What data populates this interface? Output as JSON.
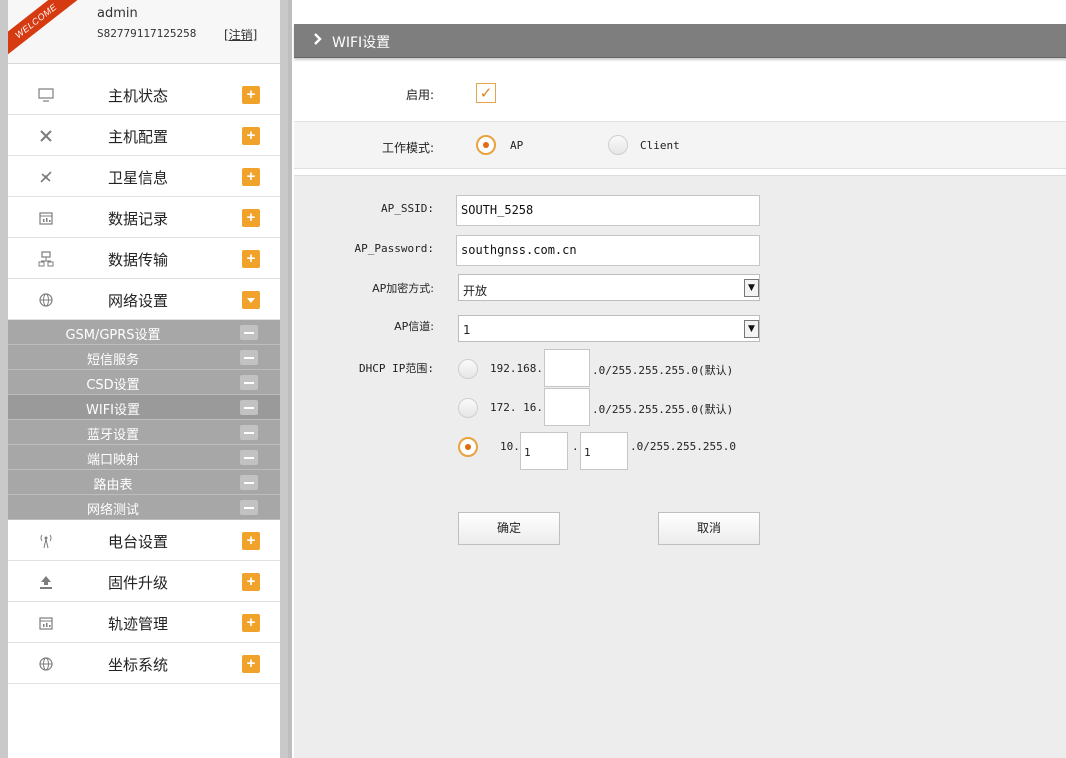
{
  "user": {
    "welcome": "WELCOME",
    "name": "admin",
    "serial": "S82779117125258",
    "logout": "[注销]"
  },
  "menu": [
    {
      "label": "主机状态",
      "icon": "monitor-icon",
      "expanded": false
    },
    {
      "label": "主机配置",
      "icon": "tools-icon",
      "expanded": false
    },
    {
      "label": "卫星信息",
      "icon": "satellite-icon",
      "expanded": false
    },
    {
      "label": "数据记录",
      "icon": "calendar-icon",
      "expanded": false
    },
    {
      "label": "数据传输",
      "icon": "network-icon",
      "expanded": false
    },
    {
      "label": "网络设置",
      "icon": "globe-icon",
      "expanded": true
    }
  ],
  "submenu": [
    "GSM/GPRS设置",
    "短信服务",
    "CSD设置",
    "WIFI设置",
    "蓝牙设置",
    "端口映射",
    "路由表",
    "网络测试"
  ],
  "submenu_active": "WIFI设置",
  "menu_bottom": [
    {
      "label": "电台设置",
      "icon": "antenna-icon"
    },
    {
      "label": "固件升级",
      "icon": "upload-icon"
    },
    {
      "label": "轨迹管理",
      "icon": "calendar-icon"
    },
    {
      "label": "坐标系统",
      "icon": "globe-icon"
    }
  ],
  "colors": {
    "accent": "#f0a22a",
    "header": "#7e7e7e",
    "submenu": "#a7a7a7"
  },
  "page": {
    "title": "WIFI设置",
    "enable_label": "启用:",
    "enable_checked": true,
    "mode_label": "工作模式:",
    "mode_ap": "AP",
    "mode_client": "Client",
    "mode_selected": "AP"
  },
  "ap": {
    "ssid_label": "AP_SSID:",
    "ssid_value": "SOUTH_5258",
    "password_label": "AP_Password:",
    "password_value": "southgnss.com.cn",
    "encrypt_label": "AP加密方式:",
    "encrypt_value": "开放",
    "channel_label": "AP信道:",
    "channel_value": "1",
    "dhcp_label": "DHCP IP范围:",
    "dhcp_options": [
      {
        "prefix": "192.168.",
        "value": "",
        "suffix": ".0/255.255.255.0(默认)",
        "selected": false
      },
      {
        "prefix": "172. 16.",
        "value": "",
        "suffix": ".0/255.255.255.0(默认)",
        "selected": false
      },
      {
        "prefix": "10.",
        "value1": "1",
        "value2": "1",
        "suffix": ".0/255.255.255.0",
        "selected": true
      }
    ],
    "ok_button": "确定",
    "cancel_button": "取消"
  }
}
